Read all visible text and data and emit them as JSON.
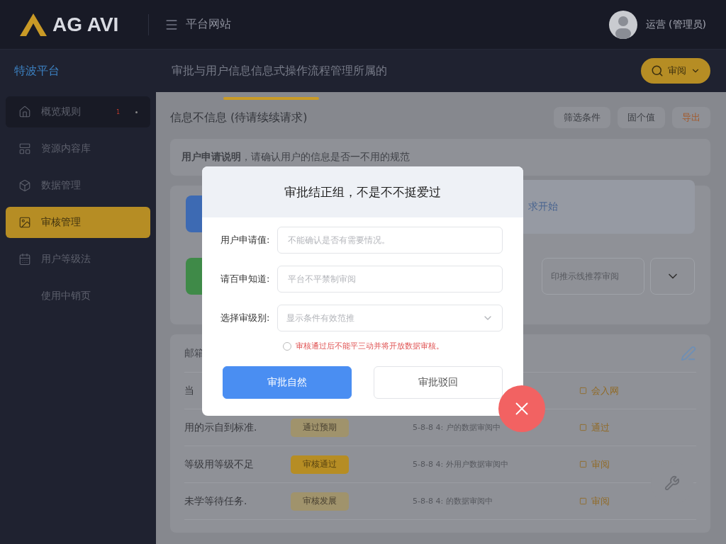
{
  "topbar": {
    "brand": "AG AVI",
    "menu_label": "平台网站",
    "user": "运营 (管理员)"
  },
  "subbar": {
    "sidebar_title": "特波平台",
    "page_title": "审批与用户信息信息式操作流程管理所属的",
    "search_button": "审阅"
  },
  "sidebar": {
    "items": [
      {
        "label": "概览规则",
        "badge": "1",
        "selected": false
      },
      {
        "label": "资源内容库",
        "selected": false
      },
      {
        "label": "数据管理",
        "selected": false
      },
      {
        "label": "审核管理",
        "selected": true
      },
      {
        "label": "用户等级法",
        "selected": false
      },
      {
        "label": "使用中销页",
        "selected": false
      }
    ]
  },
  "section": {
    "title": "信息不信息 (待请续续请求)",
    "actions": [
      {
        "label": "筛选条件",
        "kind": "plain"
      },
      {
        "label": "固个值",
        "kind": "plain"
      },
      {
        "label": "导出",
        "kind": "accent"
      }
    ]
  },
  "notice": {
    "text": "**用户申请说明**，请确认用户的信息是否一不用的规范"
  },
  "panel": {
    "link_text": "求开始",
    "field_placeholder": "印推示线推荐审阅"
  },
  "table": {
    "heading": "邮箱",
    "rows": [
      {
        "name": "当",
        "action": "会入网"
      },
      {
        "name": "用的示自到标准.",
        "status": "通过预期",
        "kind": "pale",
        "detail": "5-8-8 4: 户的数据审阅中",
        "action": "通过"
      },
      {
        "name": "等级用等级不足",
        "status": "审核通过",
        "kind": "strong",
        "detail": "5-8-8 4: 外用户数据审阅中",
        "action": "审阅"
      },
      {
        "name": "未学等待任务.",
        "status": "审核发展",
        "kind": "pale",
        "detail": "5-8-8 4: 的数据审阅中",
        "action": "审阅"
      }
    ]
  },
  "dialog": {
    "title": "审批结正组，不是不不挺爱过",
    "fields": [
      {
        "label": "用户申请值:",
        "placeholder": "不能确认是否有需要情况。",
        "kind": "input"
      },
      {
        "label": "请百申知道:",
        "placeholder": "平台不平禁制审阅",
        "kind": "input"
      },
      {
        "label": "选择审级别:",
        "placeholder": "显示条件有效范推",
        "kind": "select"
      }
    ],
    "notice": {
      "text": "审核通过后不能平三动并将开放数据审核。",
      "checked": false
    },
    "buttons": [
      {
        "label": "审批自然",
        "kind": "primary"
      },
      {
        "label": "审批驳回",
        "kind": "secondary"
      }
    ]
  }
}
